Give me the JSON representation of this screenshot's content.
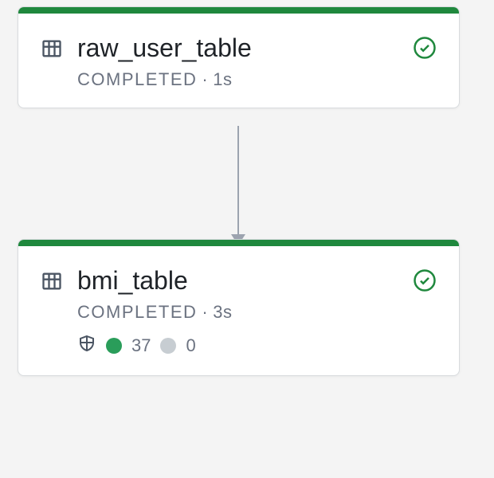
{
  "colors": {
    "success_bar": "#1f883d",
    "success_check": "#1f883d",
    "metric_pass": "#2a9d5a",
    "metric_neutral": "#c7cdd2"
  },
  "nodes": [
    {
      "id": "node1",
      "title": "raw_user_table",
      "status": "COMPLETED",
      "duration": "1s",
      "has_metrics": false
    },
    {
      "id": "node2",
      "title": "bmi_table",
      "status": "COMPLETED",
      "duration": "3s",
      "has_metrics": true,
      "metrics": {
        "pass_count": "37",
        "neutral_count": "0"
      }
    }
  ],
  "edges": [
    {
      "from": "node1",
      "to": "node2"
    }
  ]
}
